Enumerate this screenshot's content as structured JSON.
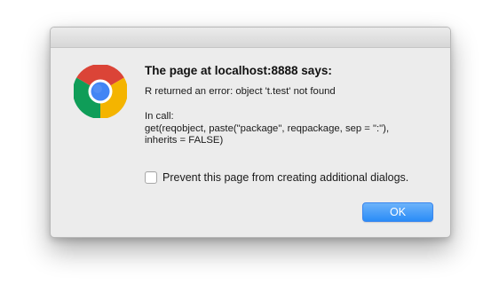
{
  "dialog": {
    "title": "The page at localhost:8888 says:",
    "error_line": "R returned an error: object 't.test' not found",
    "call_label": "In call:",
    "call_code": "get(reqobject, paste(\"package\", reqpackage, sep = \":\"),\ninherits = FALSE)",
    "checkbox": {
      "label": "Prevent this page from creating additional dialogs.",
      "checked": false
    },
    "ok_label": "OK",
    "icon": "chrome-logo-icon",
    "colors": {
      "background": "#ececec",
      "ok_button": "#2a8cf7",
      "chrome_red": "#db4437",
      "chrome_green": "#0f9d58",
      "chrome_yellow": "#f4b400",
      "chrome_blue": "#4285f4"
    }
  }
}
